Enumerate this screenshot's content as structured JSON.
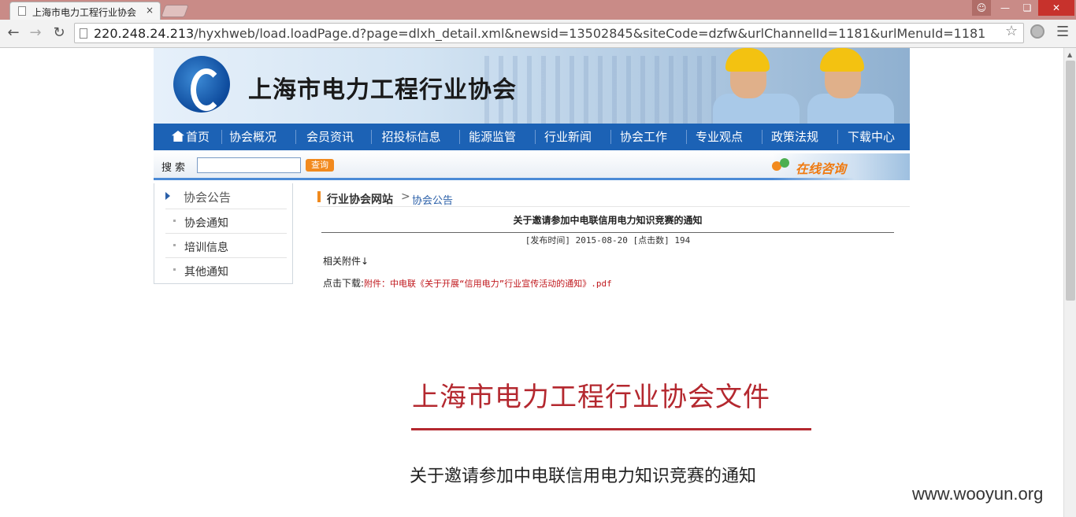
{
  "browser": {
    "tab_title": "上海市电力工程行业协会",
    "tab_close": "×",
    "url_host": "220.248.24.213",
    "url_path": "/hyxhweb/load.loadPage.d?page=dlxh_detail.xml&newsid=13502845&siteCode=dzfw&urlChannelId=1181&urlMenuId=1181"
  },
  "site": {
    "title": "上海市电力工程行业协会"
  },
  "nav": {
    "items": [
      "首页",
      "协会概况",
      "会员资讯",
      "招投标信息",
      "能源监管",
      "行业新闻",
      "协会工作",
      "专业观点",
      "政策法规",
      "下载中心"
    ]
  },
  "search": {
    "label": "搜索",
    "button": "查询",
    "value": ""
  },
  "consult": {
    "label": "在线咨询"
  },
  "sidebar": {
    "head": "协会公告",
    "items": [
      "协会通知",
      "培训信息",
      "其他通知"
    ]
  },
  "breadcrumb": {
    "home": "行业协会网站",
    "sep": ">",
    "current": "协会公告"
  },
  "article": {
    "title": "关于邀请参加中电联信用电力知识竞赛的通知",
    "meta": "[发布时间] 2015-08-20 [点击数] 194",
    "attachments_label": "相关附件↓",
    "download_label": "点击下载:",
    "download_link": "附件：中电联《关于开展“信用电力”行业宣传活动的通知》.pdf"
  },
  "document": {
    "heading": "上海市电力工程行业协会文件",
    "subtitle": "关于邀请参加中电联信用电力知识竞赛的通知"
  },
  "watermark": "www.wooyun.org"
}
